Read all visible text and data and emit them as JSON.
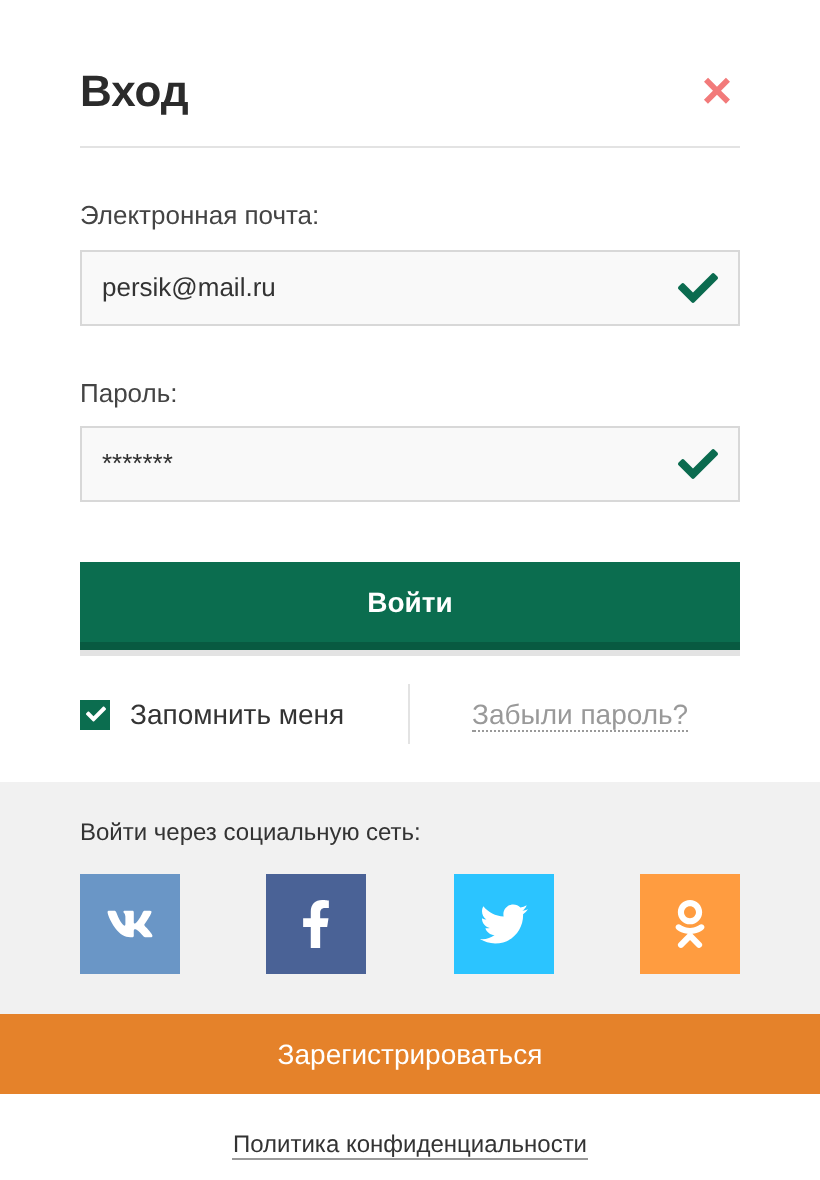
{
  "dialog": {
    "title": "Вход",
    "close": "×"
  },
  "fields": [
    {
      "label": "Электронная почта:",
      "value": "persik@mail.ru",
      "valid": true
    },
    {
      "label": "Пароль:",
      "value": "*******",
      "valid": true
    }
  ],
  "submit": "Войти",
  "remember": {
    "label": "Запомнить меня",
    "checked": true
  },
  "forgot": "Забыли пароль?",
  "social": {
    "heading": "Войти через социальную сеть:",
    "networks": [
      {
        "kind": "vk",
        "color": "#6a96c6"
      },
      {
        "kind": "facebook",
        "color": "#4a6296"
      },
      {
        "kind": "twitter",
        "color": "#2bc4ff"
      },
      {
        "kind": "odnoklassniki",
        "color": "#ff9c40"
      }
    ]
  },
  "register": "Зарегистрироваться",
  "policy": "Политика конфиденциальности"
}
